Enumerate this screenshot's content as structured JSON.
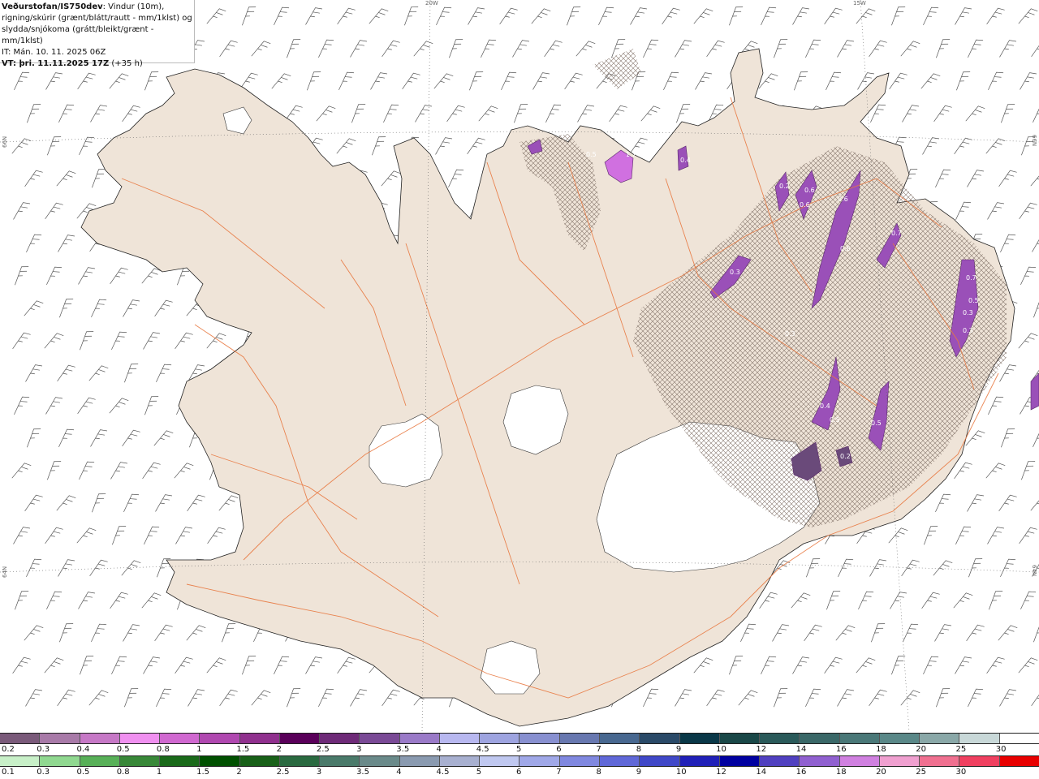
{
  "header": {
    "source": "Veðurstofan/IS750dev",
    "line1_rest": ": Vindur (10m),",
    "line2": "rigning/skúrir (grænt/blátt/rautt - mm/1klst) og",
    "line3": "slydda/snjókoma (grátt/bleikt/grænt - mm/1klst)",
    "line4": "IT: Mán. 10. 11. 2025 06Z",
    "line5_bold": "VT: þri. 11.11.2025 17Z",
    "line5_rest": " (+35 h)"
  },
  "graticule": {
    "lon_20w": "20W",
    "lon_15w": "15W",
    "lat_66n_left": "66N",
    "lat_66n_right": "66N",
    "lat_64n_left": "64N",
    "lat_64n_right": "64N"
  },
  "map_labels": [
    "0.5",
    "1.7",
    "0.4",
    "0.2",
    "0.6",
    "0.6",
    "0.6",
    "0.7",
    "0.3",
    "0.6",
    "0.3",
    "0.7",
    "0.5",
    "0.3",
    "0.3",
    "0.4",
    "0.5",
    "0.5",
    "0.2"
  ],
  "legend_top": {
    "labels": [
      "0.2",
      "0.3",
      "0.4",
      "0.5",
      "0.8",
      "1",
      "1.5",
      "2",
      "2.5",
      "3",
      "3.5",
      "4",
      "4.5",
      "5",
      "6",
      "7",
      "8",
      "9",
      "10",
      "12",
      "14",
      "16",
      "18",
      "20",
      "25",
      "30"
    ],
    "colors": [
      "#7a5a7a",
      "#a87aa8",
      "#c678c6",
      "#f090f0",
      "#d068d0",
      "#b048b0",
      "#90308e",
      "#5a005a",
      "#6e2a78",
      "#7a4a96",
      "#9a7ac8",
      "#b8b8f0",
      "#9ea4e0",
      "#8890d0",
      "#6878b0",
      "#486890",
      "#2a4a68",
      "#0a3848",
      "#1a4848",
      "#2a5a5a",
      "#3a6868",
      "#4a7878",
      "#5a8888",
      "#8aa8a8",
      "#c8d8d8",
      "#ffffff"
    ]
  },
  "legend_bottom": {
    "labels": [
      "0.1",
      "0.3",
      "0.5",
      "0.8",
      "1",
      "1.5",
      "2",
      "2.5",
      "3",
      "3.5",
      "4",
      "4.5",
      "5",
      "6",
      "7",
      "8",
      "9",
      "10",
      "12",
      "14",
      "16",
      "18",
      "20",
      "25",
      "30"
    ],
    "colors": [
      "#c8f0c8",
      "#90d890",
      "#58b058",
      "#388838",
      "#1a6a1a",
      "#005000",
      "#186018",
      "#2a6a40",
      "#4a7a6a",
      "#6a8a8a",
      "#8a9ab0",
      "#a8b0d0",
      "#c0c8f0",
      "#a0a8e8",
      "#8088e0",
      "#6068d8",
      "#4048c8",
      "#2020b8",
      "#0000a0",
      "#5040c0",
      "#9060d0",
      "#d080e0",
      "#f0a0d0",
      "#f07090",
      "#f04060",
      "#e80000"
    ]
  },
  "colors": {
    "land": "#efe4d8",
    "coast": "#222222",
    "roads": "#e87840",
    "snow_purple": "#9a50b8",
    "hatch": "#7a6a60"
  }
}
